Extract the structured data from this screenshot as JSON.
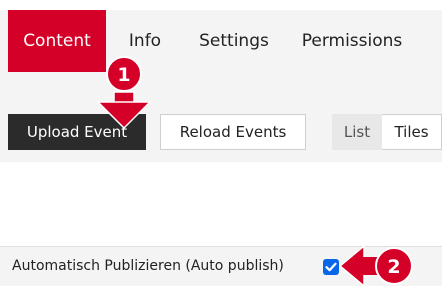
{
  "tabs": [
    {
      "label": "Content",
      "active": true
    },
    {
      "label": "Info",
      "active": false
    },
    {
      "label": "Settings",
      "active": false
    },
    {
      "label": "Permissions",
      "active": false
    }
  ],
  "toolbar": {
    "upload_label": "Upload Event",
    "reload_label": "Reload Events",
    "view_list_label": "List",
    "view_tiles_label": "Tiles",
    "active_view": "List"
  },
  "setting": {
    "label": "Automatisch Publizieren (Auto publish)",
    "checked": true
  },
  "annotations": [
    {
      "number": "1",
      "color": "#d40028"
    },
    {
      "number": "2",
      "color": "#d40028"
    }
  ],
  "colors": {
    "brand_red": "#d40028",
    "dark_button": "#2b2b2b",
    "checkbox_blue": "#0a66e8"
  }
}
